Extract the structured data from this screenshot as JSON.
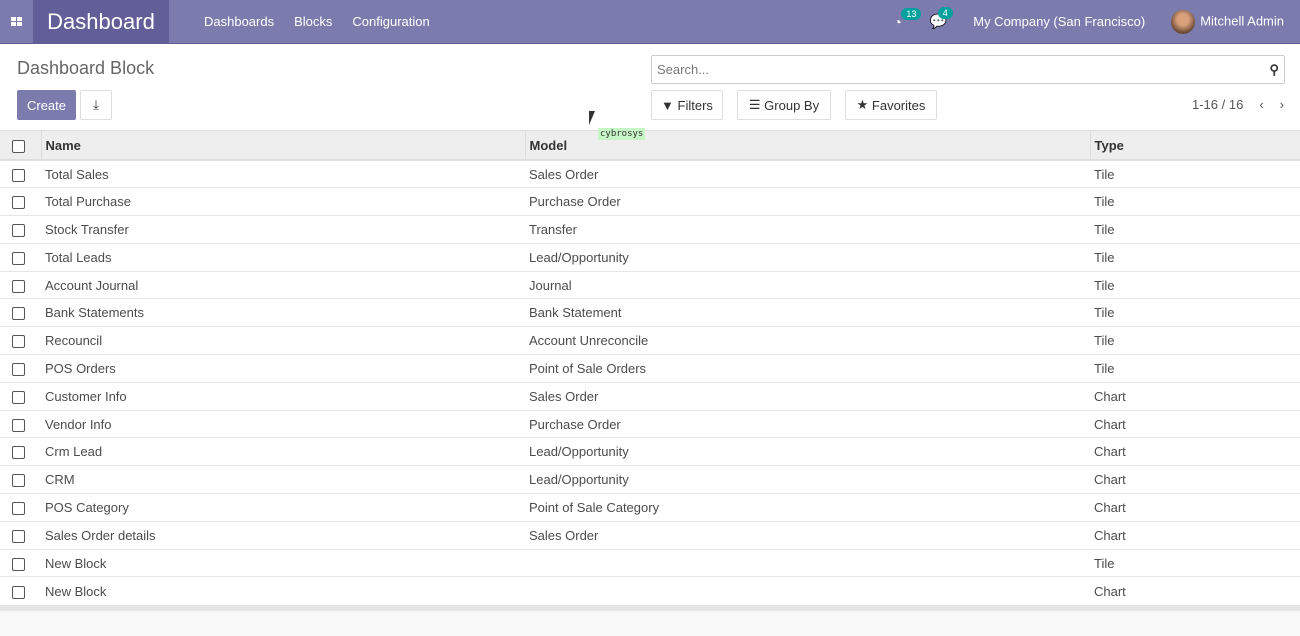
{
  "nav": {
    "brand": "Dashboard",
    "menu": [
      "Dashboards",
      "Blocks",
      "Configuration"
    ],
    "activity_count": "13",
    "message_count": "4",
    "company": "My Company (San Francisco)",
    "user": "Mitchell Admin"
  },
  "control": {
    "title": "Dashboard Block",
    "create": "Create",
    "search_placeholder": "Search...",
    "filters": "Filters",
    "group_by": "Group By",
    "favorites": "Favorites",
    "pager": "1-16 / 16",
    "cursor_tag": "cybrosys"
  },
  "table": {
    "headers": [
      "Name",
      "Model",
      "Type"
    ],
    "rows": [
      [
        "Total Sales",
        "Sales Order",
        "Tile"
      ],
      [
        "Total Purchase",
        "Purchase Order",
        "Tile"
      ],
      [
        "Stock Transfer",
        "Transfer",
        "Tile"
      ],
      [
        "Total Leads",
        "Lead/Opportunity",
        "Tile"
      ],
      [
        "Account Journal",
        "Journal",
        "Tile"
      ],
      [
        "Bank Statements",
        "Bank Statement",
        "Tile"
      ],
      [
        "Recouncil",
        "Account Unreconcile",
        "Tile"
      ],
      [
        "POS Orders",
        "Point of Sale Orders",
        "Tile"
      ],
      [
        "Customer Info",
        "Sales Order",
        "Chart"
      ],
      [
        "Vendor Info",
        "Purchase Order",
        "Chart"
      ],
      [
        "Crm Lead",
        "Lead/Opportunity",
        "Chart"
      ],
      [
        "CRM",
        "Lead/Opportunity",
        "Chart"
      ],
      [
        "POS Category",
        "Point of Sale Category",
        "Chart"
      ],
      [
        "Sales Order details",
        "Sales Order",
        "Chart"
      ],
      [
        "New Block",
        "",
        "Tile"
      ],
      [
        "New Block",
        "",
        "Chart"
      ]
    ]
  }
}
